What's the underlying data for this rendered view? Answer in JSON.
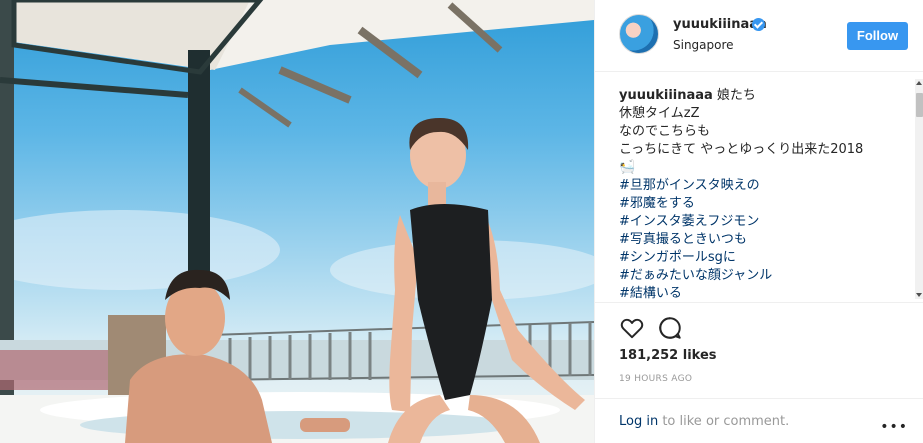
{
  "post": {
    "username": "yuuukiiinaaa",
    "location": "Singapore",
    "follow_label": "Follow",
    "caption_author": "yuuukiiinaaa",
    "caption_first": "娘たち",
    "caption_lines": [
      "休憩タイムzZ",
      "なのでこちらも",
      "こっちにきて やっとゆっくり出来た2018",
      "🛀"
    ],
    "hashtags": [
      "#旦那がインスタ映えの",
      "#邪魔をする",
      "#インスタ萎えフジモン",
      "#写真撮るときいつも",
      "#シンガポールsgに",
      "#だぁみたいな顔ジャンル",
      "#結構いる"
    ],
    "likes": "181,252 likes",
    "time": "19 HOURS AGO",
    "login_link": "Log in",
    "comment_prompt": " to like or comment.",
    "more": "•••"
  },
  "colors": {
    "accent": "#3897f0",
    "link": "#003569",
    "muted": "#999999"
  },
  "icons": {
    "heart": "heart-icon",
    "comment": "comment-icon",
    "verified": "verified-badge-icon",
    "more": "more-options-icon"
  }
}
